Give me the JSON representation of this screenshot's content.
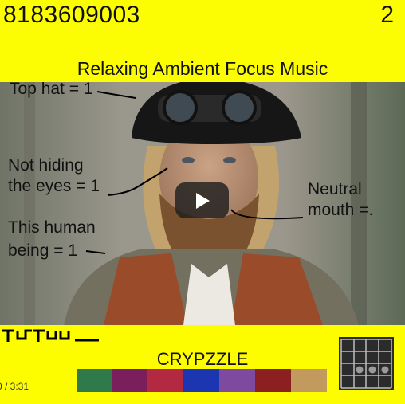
{
  "header": {
    "video_id": "8183609003",
    "level": "2",
    "title": "Relaxing Ambient Focus Music"
  },
  "annotations": {
    "top_hat": "Top hat = 1",
    "eyes_line1": "Not hiding",
    "eyes_line2": "the eyes = 1",
    "mouth_line1": "Neutral",
    "mouth_line2": "mouth =.",
    "human_line1": "This human",
    "human_line2": "being = 1"
  },
  "footer": {
    "game_name": "CRYPZZLE",
    "time": "0 / 3:31"
  },
  "palette": [
    "#2f7a4a",
    "#7a1f5c",
    "#b32942",
    "#1c36b2",
    "#7d4aa0",
    "#8c1f1f",
    "#c29a5e"
  ],
  "icons": {
    "play": "play-icon",
    "glyph": "maze-glyph-icon",
    "grid": "grid-puzzle-icon"
  }
}
